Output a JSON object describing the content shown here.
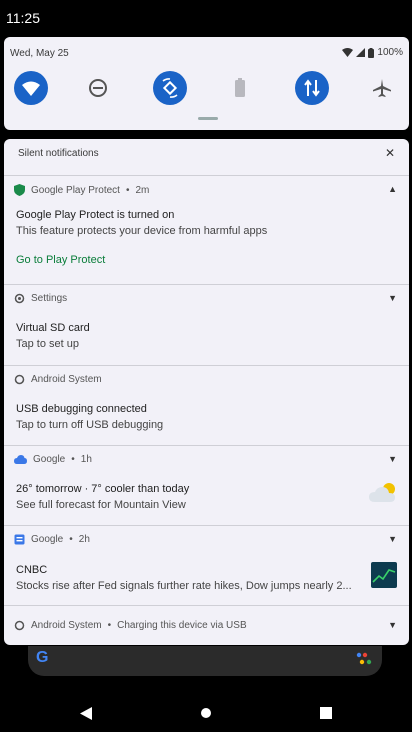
{
  "status_bar": {
    "time": "11:25"
  },
  "quick_settings": {
    "date": "Wed, May 25",
    "battery": "100%",
    "tiles": [
      {
        "name": "wifi",
        "state": "on"
      },
      {
        "name": "do-not-disturb",
        "state": "off"
      },
      {
        "name": "auto-rotate",
        "state": "on"
      },
      {
        "name": "battery-saver",
        "state": "off"
      },
      {
        "name": "mobile-data",
        "state": "on"
      },
      {
        "name": "airplane-mode",
        "state": "off"
      }
    ]
  },
  "notifications": {
    "header": "Silent notifications",
    "items": [
      {
        "app": "Google Play Protect",
        "time": "2m",
        "title": "Google Play Protect is turned on",
        "text": "This feature protects your device from harmful apps",
        "action": "Go to Play Protect"
      },
      {
        "app": "Settings",
        "title": "Virtual SD card",
        "text": "Tap to set up"
      },
      {
        "app": "Android System",
        "title": "USB debugging connected",
        "text": "Tap to turn off USB debugging"
      },
      {
        "app": "Google",
        "time": "1h",
        "title": "26° tomorrow · 7° cooler than today",
        "text": "See full forecast for Mountain View"
      },
      {
        "app": "Google",
        "time": "2h",
        "title": "CNBC",
        "text": "Stocks rise after Fed signals further rate hikes, Dow jumps nearly 2..."
      },
      {
        "app": "Android System",
        "text": "Charging this device via USB"
      }
    ]
  },
  "colors": {
    "accent": "#1a63c7",
    "panel": "#f2f1f8",
    "link": "#0a7d3a"
  }
}
